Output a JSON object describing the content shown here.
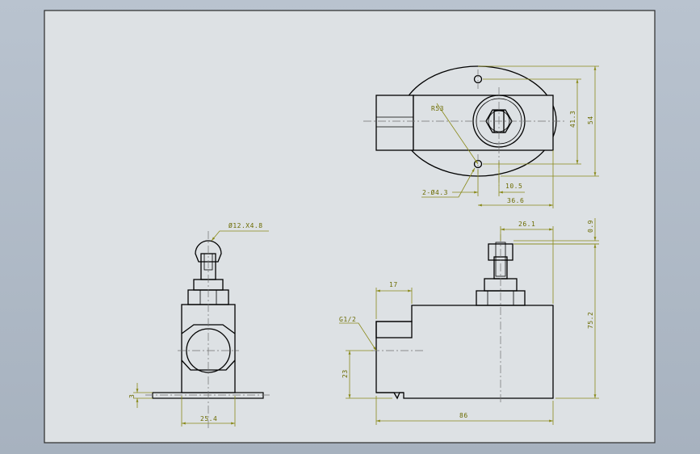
{
  "sheet": {
    "background": "#b3bdc9",
    "paper": "#dde1e4",
    "dim_color": "#6b6b00"
  },
  "views": {
    "top": {
      "radius_label": "R53",
      "hole_label": "2-Ø4.3",
      "dim_a": "10.5",
      "dim_b": "36.6",
      "dim_c": "41.3",
      "dim_d": "54"
    },
    "side": {
      "ball_label": "Ø12.X4.8",
      "width_label": "25.4",
      "thickness_label": "3"
    },
    "front": {
      "thread_label": "G1/2",
      "dim_17": "17",
      "dim_26": "26.1",
      "dim_09": "0.9",
      "dim_752": "75.2",
      "dim_23": "23",
      "dim_86": "86"
    }
  }
}
